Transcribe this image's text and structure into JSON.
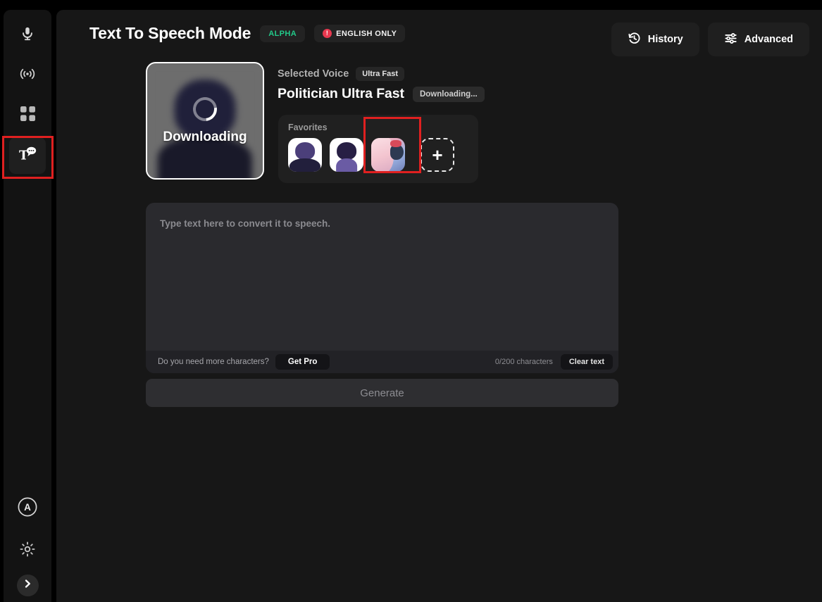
{
  "sidebar": {
    "top_items": [
      {
        "name": "voice-changer",
        "icon": "microphone-icon",
        "active": false
      },
      {
        "name": "soundboard-live",
        "icon": "broadcast-icon",
        "active": false
      },
      {
        "name": "apps-grid",
        "icon": "grid-icon",
        "active": false
      },
      {
        "name": "text-to-speech",
        "icon": "text-to-speech-icon",
        "active": true
      }
    ],
    "bottom_items": [
      {
        "name": "account",
        "icon": "account-avatar-icon",
        "label": "A"
      },
      {
        "name": "settings",
        "icon": "gear-icon"
      },
      {
        "name": "expand-sidebar",
        "icon": "chevron-right-icon"
      }
    ]
  },
  "header": {
    "title": "Text To Speech Mode",
    "badge_alpha": "ALPHA",
    "badge_english": "ENGLISH ONLY",
    "warning_glyph": "!",
    "history_label": "History",
    "advanced_label": "Advanced"
  },
  "voice_card": {
    "status_label": "Downloading"
  },
  "selected_voice": {
    "label": "Selected Voice",
    "speed_chip": "Ultra Fast",
    "name": "Politician Ultra Fast",
    "status": "Downloading..."
  },
  "favorites": {
    "title": "Favorites",
    "items": [
      {
        "name": "favorite-voice-1",
        "style": "suit-male"
      },
      {
        "name": "favorite-voice-2",
        "style": "long-hair-female"
      },
      {
        "name": "favorite-voice-3",
        "style": "anime-headphones"
      }
    ],
    "add_label": "+"
  },
  "editor": {
    "value": "",
    "placeholder": "Type text here to convert it to speech.",
    "footer_note": "Do you need more characters?",
    "get_pro_label": "Get Pro",
    "char_count": "0/200 characters",
    "clear_label": "Clear text"
  },
  "generate": {
    "label": "Generate"
  },
  "colors": {
    "background": "#171717",
    "sidebar": "#131313",
    "panel": "#202020",
    "editor": "#2a2a2e",
    "accent_green": "#22c989",
    "accent_red": "#e8384f",
    "annotation_red": "#e02020"
  }
}
